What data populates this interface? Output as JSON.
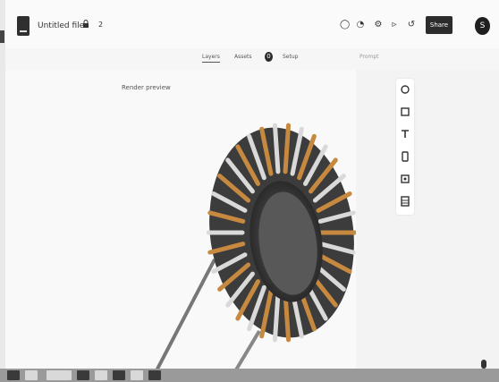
{
  "app": {
    "title": "Untitled file",
    "share_count": "2",
    "action_label": "Share"
  },
  "toolbar": {
    "tools": [
      {
        "icon": "comment-icon",
        "glyph": "◯"
      },
      {
        "icon": "history-icon",
        "glyph": "◔"
      },
      {
        "icon": "settings-icon",
        "glyph": "⚙"
      },
      {
        "icon": "play-icon",
        "glyph": "▹"
      },
      {
        "icon": "undo-icon",
        "glyph": "↺"
      }
    ]
  },
  "user": {
    "avatar_initial": "S"
  },
  "tabs": [
    {
      "label": "Layers"
    },
    {
      "label": "Assets"
    },
    {
      "label": "Setup"
    }
  ],
  "tab_badge": "0",
  "side_panel": {
    "label": "Prompt"
  },
  "canvas": {
    "caption": "Render preview"
  },
  "vertical_tools": [
    {
      "icon": "move-icon"
    },
    {
      "icon": "frame-icon"
    },
    {
      "icon": "text-icon"
    },
    {
      "icon": "device-icon"
    },
    {
      "icon": "image-icon"
    },
    {
      "icon": "table-icon"
    }
  ],
  "colors": {
    "background": "#f6f6f6",
    "accent": "#2c2c2c",
    "copper": "#c7893f"
  }
}
